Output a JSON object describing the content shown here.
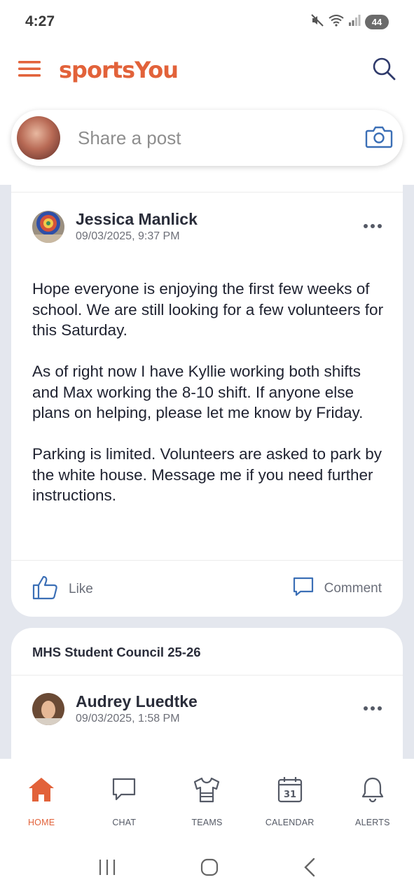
{
  "status_bar": {
    "time": "4:27",
    "battery": "44"
  },
  "header": {
    "app_name": "sportsYou"
  },
  "composer": {
    "placeholder": "Share a post"
  },
  "posts": [
    {
      "author": "Jessica Manlick",
      "date": "09/03/2025, 9:37 PM",
      "paragraphs": [
        "Hope everyone is enjoying the first few weeks of school. We are still looking for a few volunteers for this Saturday.",
        "As of right now I have Kyllie working both shifts and Max working the 8-10 shift. If anyone else plans on helping, please let me know by Friday.",
        "Parking is limited. Volunteers are asked to park by the white house. Message me if you need further instructions."
      ],
      "like_label": "Like",
      "comment_label": "Comment"
    },
    {
      "group": "MHS Student Council 25-26",
      "author": "Audrey Luedtke",
      "date": "09/03/2025, 1:58 PM"
    }
  ],
  "bottom_nav": [
    {
      "label": "HOME",
      "icon": "home-icon",
      "active": true
    },
    {
      "label": "CHAT",
      "icon": "chat-icon",
      "active": false
    },
    {
      "label": "TEAMS",
      "icon": "jersey-icon",
      "active": false
    },
    {
      "label": "CALENDAR",
      "icon": "calendar-icon",
      "active": false,
      "badge": "31"
    },
    {
      "label": "ALERTS",
      "icon": "bell-icon",
      "active": false
    }
  ],
  "colors": {
    "brand": "#e2623a",
    "feed_bg": "#e4e7ee",
    "icon_blue": "#3b6fb6"
  }
}
